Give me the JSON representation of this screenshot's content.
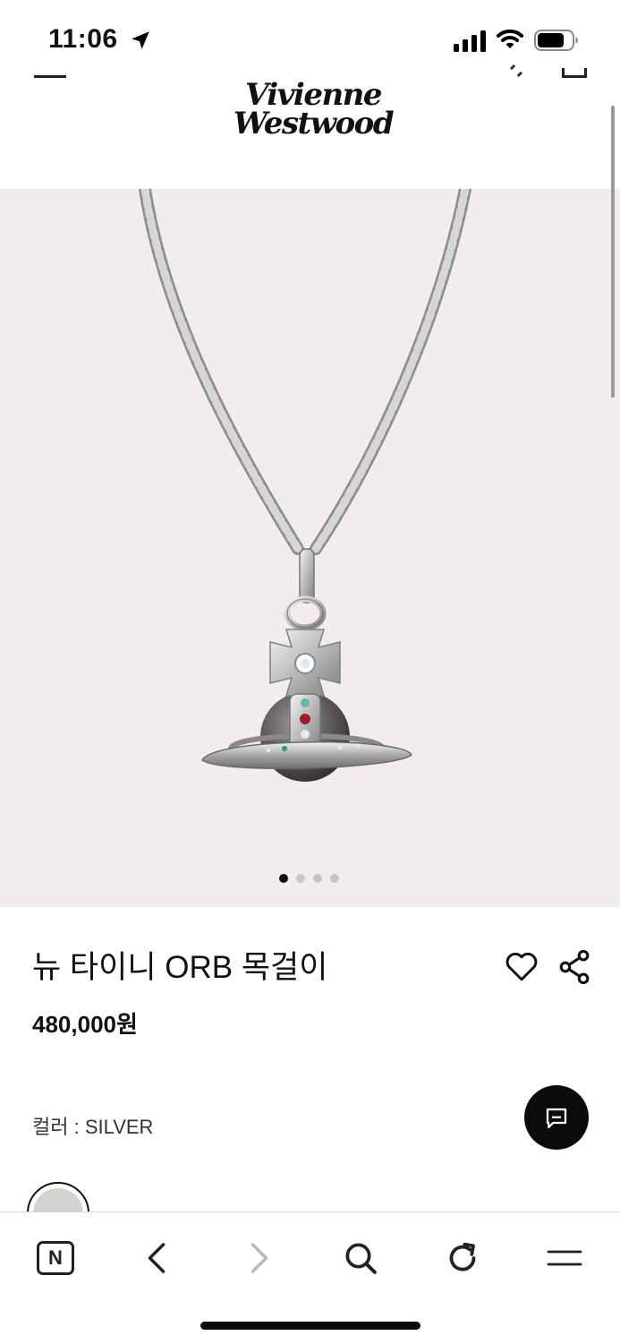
{
  "status_bar": {
    "time": "11:06",
    "icons": [
      "location-arrow-icon",
      "cellular-signal-icon",
      "wifi-icon",
      "battery-icon"
    ]
  },
  "header": {
    "brand_line1": "Vivienne",
    "brand_line2": "Westwood"
  },
  "gallery": {
    "image_subject": "silver orb pendant necklace",
    "page_count": 4,
    "active_page": 1,
    "background_color": "#f2ecec"
  },
  "product": {
    "title": "뉴 타이니 ORB 목걸이",
    "price": "480,000원",
    "color_label": "컬러 : SILVER",
    "swatch_color": "#d4d2cf"
  },
  "actions": {
    "wishlist_icon": "heart-icon",
    "share_icon": "share-icon",
    "chat_icon": "chat-bubble-icon"
  },
  "browser_toolbar": {
    "naver_label": "N",
    "icons": [
      "naver-icon",
      "back-icon",
      "forward-icon",
      "search-icon",
      "reload-icon",
      "menu-icon"
    ]
  }
}
